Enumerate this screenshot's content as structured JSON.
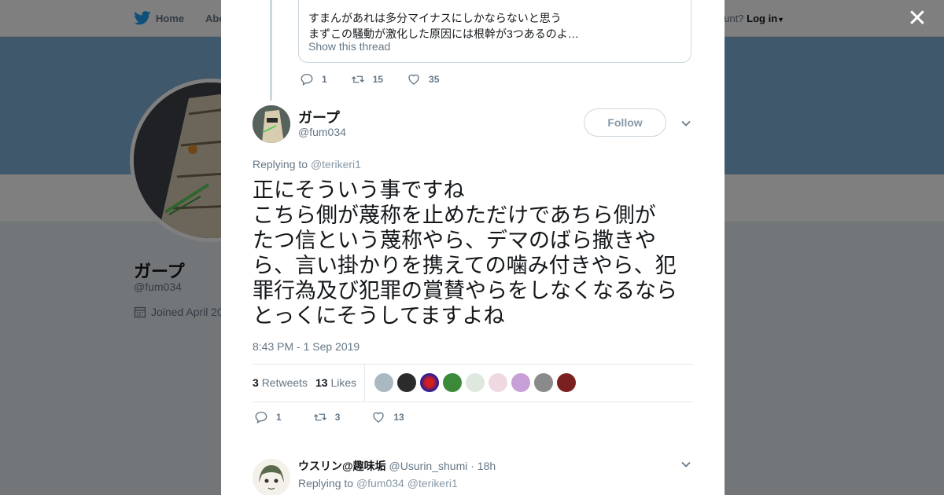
{
  "nav": {
    "home": "Home",
    "about": "Abo",
    "login_prefix": "ccount?",
    "login": "Log in"
  },
  "profile": {
    "name": "ガープ",
    "handle": "@fum034",
    "joined": "Joined April 20"
  },
  "prev_tweet": {
    "quote_lines": [
      "すまんがあれは多分マイナスにしかならないと思う",
      "まずこの騒動が激化した原因には根幹が3つあるのよ…"
    ],
    "show_thread": "Show this thread",
    "replies": "1",
    "retweets": "15",
    "likes": "35"
  },
  "tweet": {
    "author_name": "ガープ",
    "author_handle": "@fum034",
    "follow_label": "Follow",
    "replying_label": "Replying to",
    "replying_to": "@terikeri1",
    "text_lines": [
      "正にそういう事ですね",
      "こちら側が蔑称を止めただけであちら側が",
      "たつ信という蔑称やら、デマのばら撒きや",
      "ら、言い掛かりを携えての噛み付きやら、犯",
      "罪行為及び犯罪の賞賛やらをしなくなるなら",
      "とっくにそうしてますよね"
    ],
    "timestamp": "8:43 PM - 1 Sep 2019",
    "retweet_count": "3",
    "retweet_label": "Retweets",
    "like_count": "13",
    "like_label": "Likes",
    "replies": "1",
    "retweets": "3",
    "likes": "13"
  },
  "reply": {
    "name": "ウスリン@趣味垢",
    "handle": "@Usurin_shumi",
    "time": "· 18h",
    "replying_label": "Replying to",
    "mention_1": "@fum034",
    "mention_2": "@terikeri1"
  },
  "colors": {
    "twitter_blue": "#1da1f2",
    "gray": "#657786",
    "border": "#e1e8ed"
  }
}
